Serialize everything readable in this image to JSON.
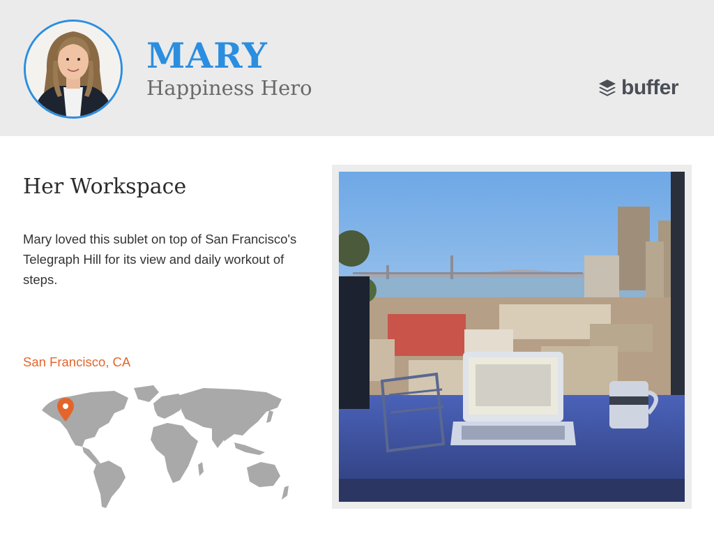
{
  "profile": {
    "name": "MARY",
    "role": "Happiness Hero"
  },
  "brand": {
    "name": "buffer",
    "icon": "buffer-stack-icon"
  },
  "workspace": {
    "title": "Her Workspace",
    "description": "Mary loved this sublet on top of San Francisco's Telegraph Hill for its view and daily workout of steps.",
    "location": "San Francisco, CA"
  },
  "colors": {
    "accent": "#2b8ee0",
    "location": "#e4652b",
    "header_bg": "#ebebeb",
    "map_land": "#a9a9a9"
  }
}
